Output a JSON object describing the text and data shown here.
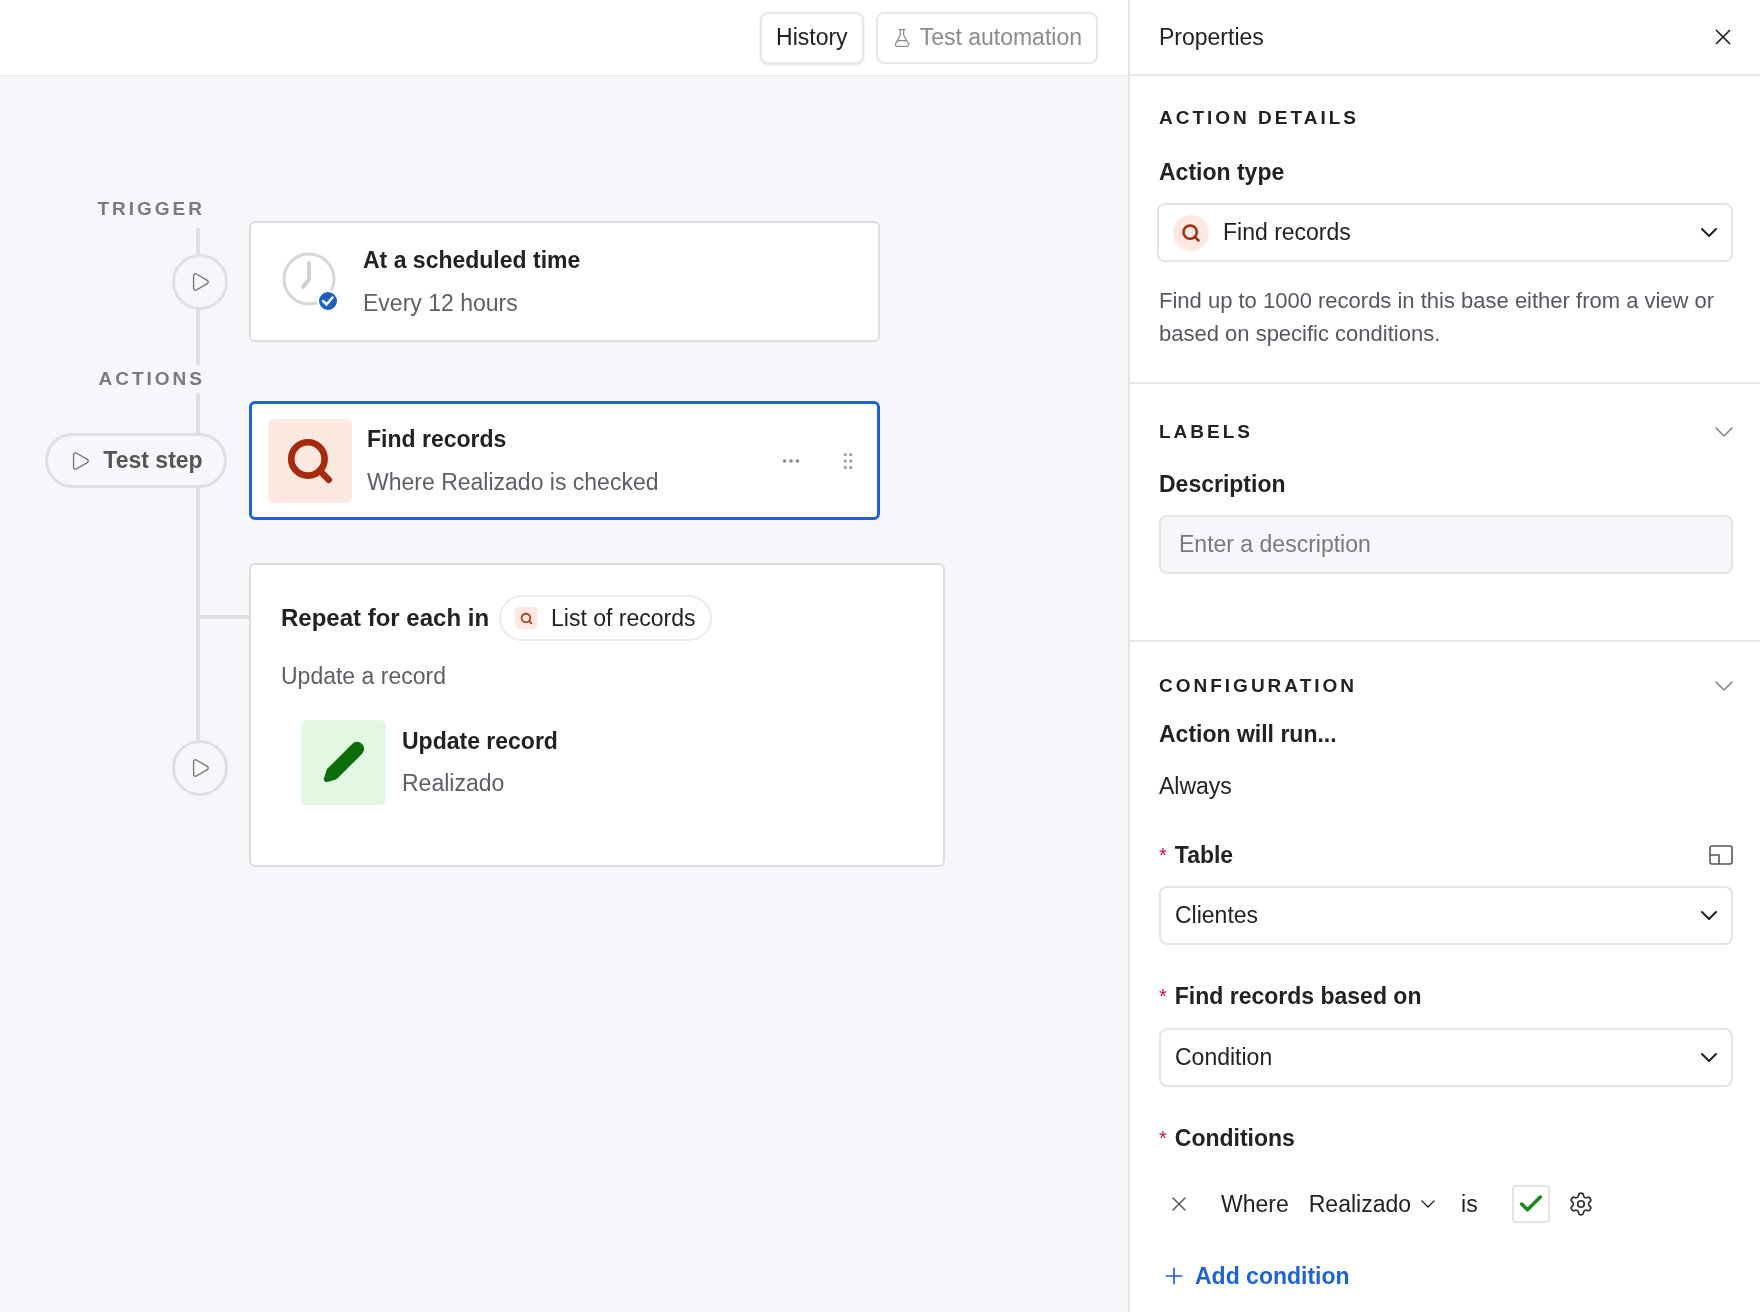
{
  "toolbar": {
    "buttons": [
      {
        "label": "History",
        "kind": "plain",
        "disabled": false
      },
      {
        "label": "Test automation",
        "kind": "flask",
        "disabled": true
      }
    ]
  },
  "canvas": {
    "trigger_label": "TRIGGER",
    "trigger": {
      "title": "At a scheduled time",
      "subtitle": "Every 12 hours",
      "selected": false
    },
    "actions_label": "ACTIONS",
    "test_step": "Test step",
    "actions": [
      {
        "kind": "find",
        "title": "Find records",
        "subtitle": "Where Realizado is checked",
        "selected": true
      }
    ],
    "loop": {
      "title": "Repeat for each in",
      "source": "List of records",
      "subtitle": "Update a record",
      "steps": [
        {
          "kind": "update",
          "title": "Update record",
          "subtitle": "Realizado"
        }
      ]
    }
  },
  "properties": {
    "title": "Properties",
    "action_details": {
      "heading": "ACTION DETAILS",
      "action_type_label": "Action type",
      "action_type": "Find records",
      "description": "Find up to 1000 records in this base either from a view or based on specific conditions."
    },
    "labels": {
      "heading": "LABELS",
      "description_label": "Description",
      "description_placeholder": "Enter a description"
    },
    "configuration": {
      "heading": "CONFIGURATION",
      "run_label": "Action will run...",
      "run_value": "Always",
      "fields": [
        {
          "required_mark": "*",
          "label": "Table",
          "value": "Clientes"
        },
        {
          "required_mark": "*",
          "label": "Find records based on",
          "value": "Condition"
        }
      ],
      "conditions_required_mark": "*",
      "conditions_label": "Conditions",
      "conditions": [
        {
          "prefix": "Where",
          "field": "Realizado",
          "operator": "is",
          "checked": true
        }
      ],
      "add_condition": "Add condition"
    }
  }
}
